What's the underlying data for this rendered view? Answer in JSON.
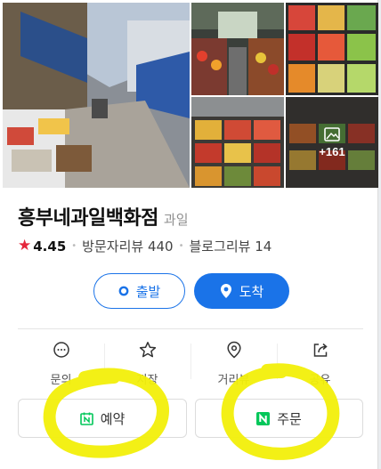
{
  "place": {
    "name": "흥부네과일백화점",
    "category": "과일",
    "rating": "4.45",
    "visitor_reviews": "방문자리뷰 440",
    "blog_reviews": "블로그리뷰 14"
  },
  "photos": {
    "more_count": "+161"
  },
  "route": {
    "depart_label": "출발",
    "arrive_label": "도착"
  },
  "actions": [
    {
      "label": "문의",
      "icon": "chat-icon"
    },
    {
      "label": "저장",
      "icon": "star-outline-icon"
    },
    {
      "label": "거리뷰",
      "icon": "location-pin-icon"
    },
    {
      "label": "공유",
      "icon": "share-icon"
    }
  ],
  "booking": {
    "reserve_label": "예약",
    "order_label": "주문"
  },
  "colors": {
    "primary_blue": "#1a73e8",
    "rating_star": "#e5263b",
    "naver_green": "#03c75a",
    "highlight": "#f2ef0a"
  }
}
